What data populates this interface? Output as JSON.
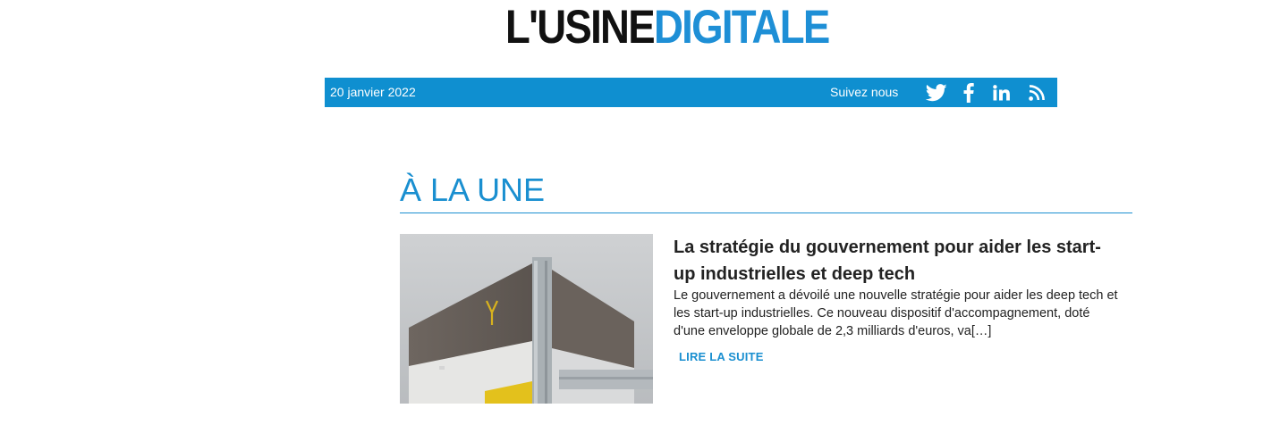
{
  "logo": {
    "part1": "L'USINE",
    "part2": "DIGITALE"
  },
  "topbar": {
    "date": "20 janvier 2022",
    "follow_label": "Suivez nous",
    "social_icons": [
      "twitter-icon",
      "facebook-icon",
      "linkedin-icon",
      "rss-icon"
    ]
  },
  "section": {
    "title": "À LA UNE"
  },
  "article": {
    "title": "La stratégie du gouvernement pour aider les start-up industrielles et deep tech",
    "excerpt": "Le gouvernement a dévoilé une nouvelle stratégie pour aider les deep tech et les start-up industrielles. Ce nouveau dispositif d'accompagnement, doté d'une enveloppe globale de 2,3 milliards d'euros, va[…]",
    "link_label": "LIRE LA SUITE"
  },
  "colors": {
    "brand_blue": "#0f8fd0",
    "logo_blue": "#1e8fd6",
    "text_dark": "#222222"
  }
}
